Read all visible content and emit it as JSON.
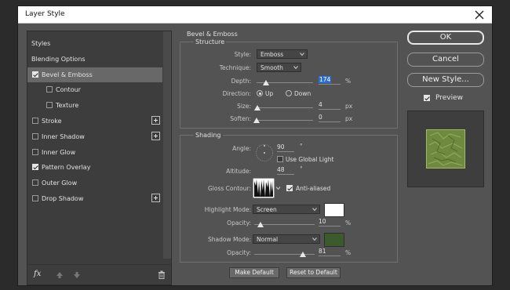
{
  "dialog": {
    "title": "Layer Style"
  },
  "left_panel": {
    "items": [
      {
        "label": "Styles",
        "checkbox": false,
        "checked": false,
        "selected": false,
        "indent": 0,
        "plus": false
      },
      {
        "label": "Blending Options",
        "checkbox": false,
        "checked": false,
        "selected": false,
        "indent": 0,
        "plus": false
      },
      {
        "label": "Bevel & Emboss",
        "checkbox": true,
        "checked": true,
        "selected": true,
        "indent": 0,
        "plus": false
      },
      {
        "label": "Contour",
        "checkbox": true,
        "checked": false,
        "selected": false,
        "indent": 1,
        "plus": false
      },
      {
        "label": "Texture",
        "checkbox": true,
        "checked": false,
        "selected": false,
        "indent": 1,
        "plus": false
      },
      {
        "label": "Stroke",
        "checkbox": true,
        "checked": false,
        "selected": false,
        "indent": 0,
        "plus": true
      },
      {
        "label": "Inner Shadow",
        "checkbox": true,
        "checked": false,
        "selected": false,
        "indent": 0,
        "plus": true
      },
      {
        "label": "Inner Glow",
        "checkbox": true,
        "checked": false,
        "selected": false,
        "indent": 0,
        "plus": false
      },
      {
        "label": "Pattern Overlay",
        "checkbox": true,
        "checked": true,
        "selected": false,
        "indent": 0,
        "plus": false
      },
      {
        "label": "Outer Glow",
        "checkbox": true,
        "checked": false,
        "selected": false,
        "indent": 0,
        "plus": false
      },
      {
        "label": "Drop Shadow",
        "checkbox": true,
        "checked": false,
        "selected": false,
        "indent": 0,
        "plus": true
      }
    ],
    "fx_label": "fx"
  },
  "bevel": {
    "group_title": "Bevel & Emboss",
    "structure_title": "Structure",
    "style_label": "Style:",
    "style_value": "Emboss",
    "technique_label": "Technique:",
    "technique_value": "Smooth",
    "depth_label": "Depth:",
    "depth_value": "174",
    "depth_unit": "%",
    "depth_level": 0.17,
    "direction_label": "Direction:",
    "direction_up": "Up",
    "direction_down": "Down",
    "direction_selected": "Up",
    "size_label": "Size:",
    "size_value": "4",
    "size_unit": "px",
    "size_level": 0.02,
    "soften_label": "Soften:",
    "soften_value": "0",
    "soften_unit": "px",
    "soften_level": 0.0
  },
  "shading": {
    "title": "Shading",
    "angle_label": "Angle:",
    "angle_value": "90",
    "angle_unit": "°",
    "global_light_label": "Use Global Light",
    "global_light_checked": false,
    "altitude_label": "Altitude:",
    "altitude_value": "48",
    "altitude_unit": "°",
    "gloss_label": "Gloss Contour:",
    "anti_aliased_label": "Anti-aliased",
    "anti_aliased_checked": true,
    "highlight_mode_label": "Highlight Mode:",
    "highlight_mode_value": "Screen",
    "highlight_color": "#ffffff",
    "highlight_opacity_label": "Opacity:",
    "highlight_opacity_value": "10",
    "highlight_opacity_unit": "%",
    "highlight_opacity_level": 0.1,
    "shadow_mode_label": "Shadow Mode:",
    "shadow_mode_value": "Normal",
    "shadow_color": "#3d5a2c",
    "shadow_opacity_label": "Opacity:",
    "shadow_opacity_value": "81",
    "shadow_opacity_unit": "%",
    "shadow_opacity_level": 0.81
  },
  "footer": {
    "make_default": "Make Default",
    "reset_default": "Reset to Default"
  },
  "right": {
    "ok": "OK",
    "cancel": "Cancel",
    "new_style": "New Style...",
    "preview_label": "Preview",
    "preview_checked": true,
    "preview_color": "#6f8a3e"
  }
}
